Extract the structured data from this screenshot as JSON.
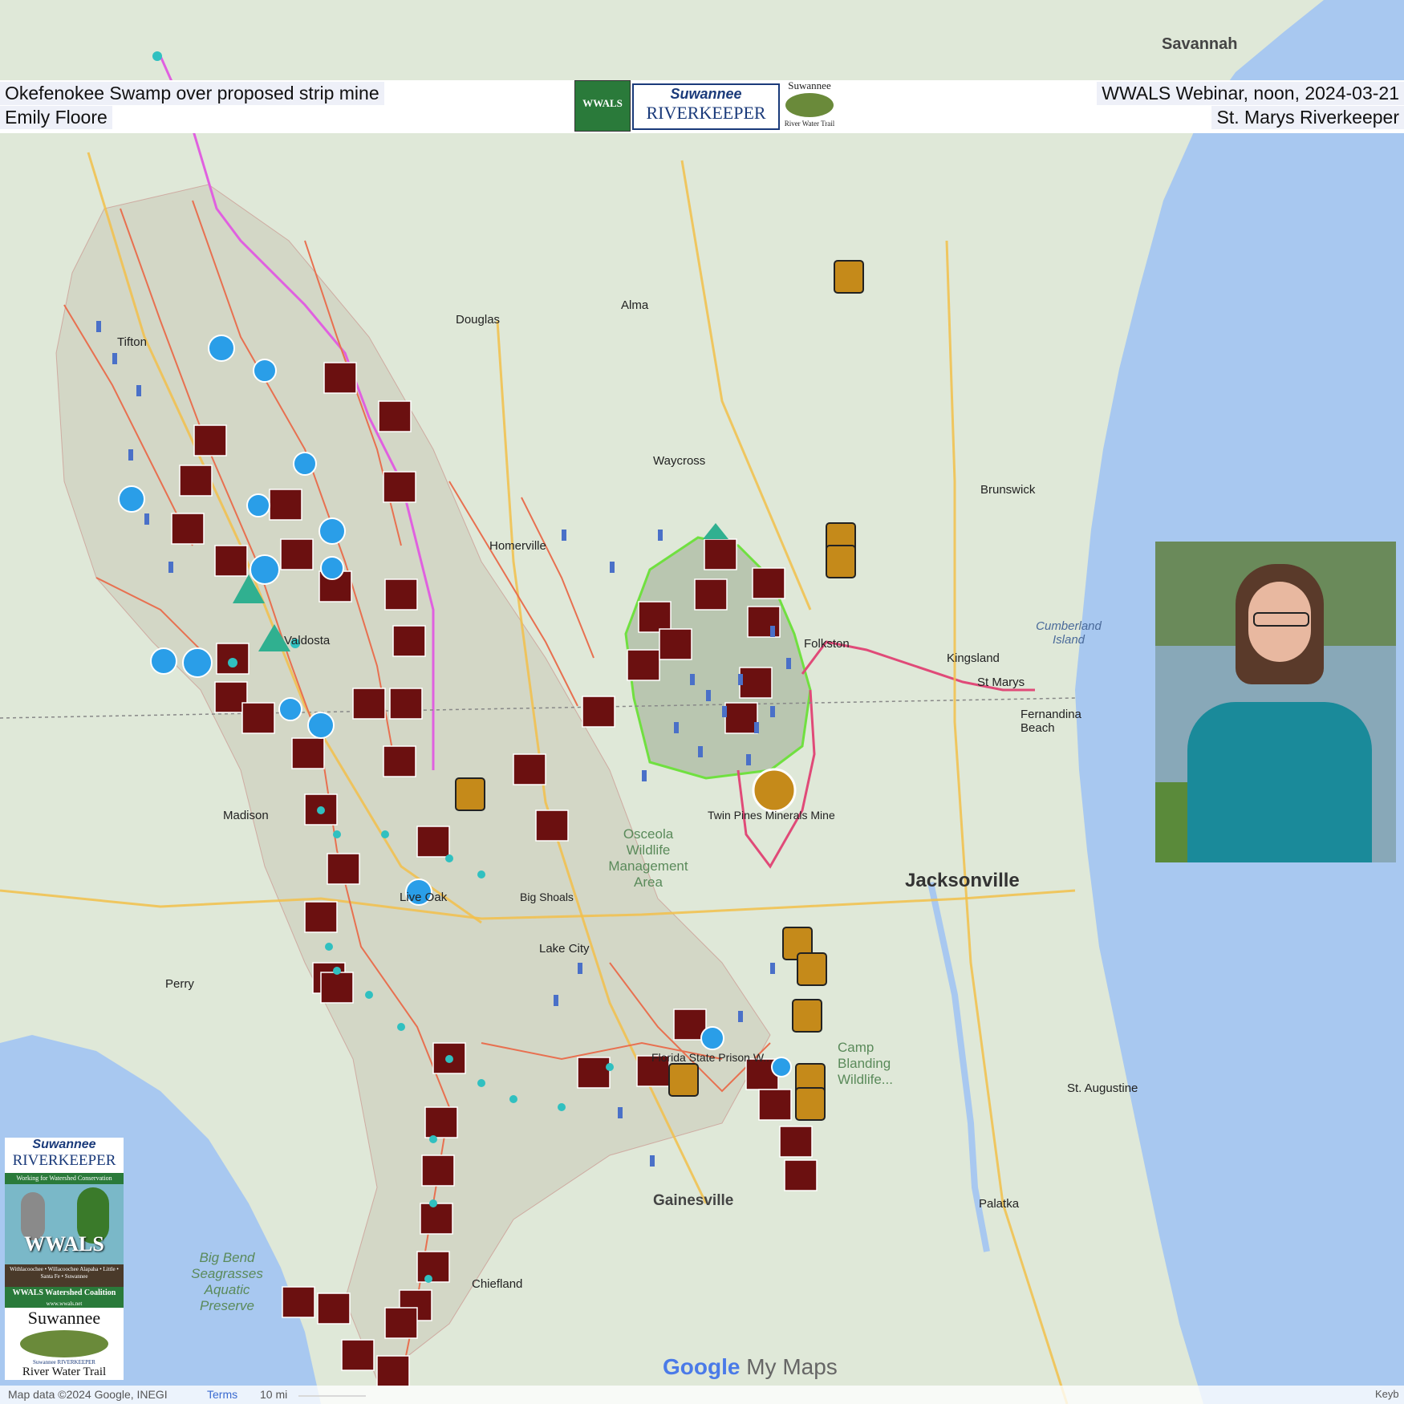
{
  "header": {
    "title_left": "Okefenokee Swamp over proposed strip mine",
    "presenter": "Emily Floore",
    "event": "WWALS Webinar, noon, 2024-03-21",
    "organization": "St. Marys Riverkeeper"
  },
  "header_logo": {
    "line1": "Suwannee",
    "line2": "RIVERKEEPER",
    "trail_top": "Suwannee",
    "trail_bottom": "River Water Trail",
    "badge": "WWALS"
  },
  "side_logo": {
    "top_line1": "Suwannee",
    "top_line2": "RIVERKEEPER",
    "tagline": "Working for Watershed Conservation",
    "wwals": "WWALS",
    "rivers": "Withlacoochee • Willacoochee Alapaha • Little • Santa Fe • Suwannee",
    "coalition": "WWALS Watershed Coalition",
    "url": "www.wwals.net",
    "trail_title": "Suwannee",
    "trail_small": "Suwannee RIVERKEEPER",
    "trail_bottom": "River Water Trail"
  },
  "map": {
    "labels": {
      "twin_pines": "Twin Pines Minerals Mine",
      "big_shoals": "Big Shoals",
      "prison": "Florida State Prison W...",
      "jacksonville": "Jacksonville",
      "savannah": "Savannah",
      "gainesville": "Gainesville",
      "osceola": "Osceola Wildlife Management Area",
      "big_bend": "Big Bend Seagrasses Aquatic Preserve",
      "waycross": "Waycross",
      "valdosta": "Valdosta",
      "fernandina": "Fernandina Beach",
      "st_marys": "St Marys",
      "kingsland": "Kingsland",
      "folkston": "Folkston",
      "homerville": "Homerville",
      "lake_city": "Lake City",
      "live_oak": "Live Oak",
      "tifton": "Tifton",
      "douglas": "Douglas",
      "brunswick": "Brunswick",
      "palatka": "Palatka",
      "st_augustine": "St. Augustine",
      "madison": "Madison",
      "perry": "Perry",
      "chiefland": "Chiefland",
      "alma": "Alma",
      "camp_blanding": "Camp Blanding Wildlife...",
      "cumberland": "Cumberland Island"
    }
  },
  "footer": {
    "attribution": "Map data ©2024 Google, INEGI",
    "terms": "Terms",
    "scale": "10 mi",
    "brand_google": "Google",
    "brand_mymaps": "My Maps",
    "keyboard": "Keyb"
  },
  "colors": {
    "ocean": "#a8c8f0",
    "land": "#dfe8d8",
    "river_red": "#e87050",
    "boundary_pink": "#e04a78",
    "launch_brown": "#6b1010",
    "mine_gold": "#c58a1a",
    "refuge_green": "#7ff04a"
  }
}
